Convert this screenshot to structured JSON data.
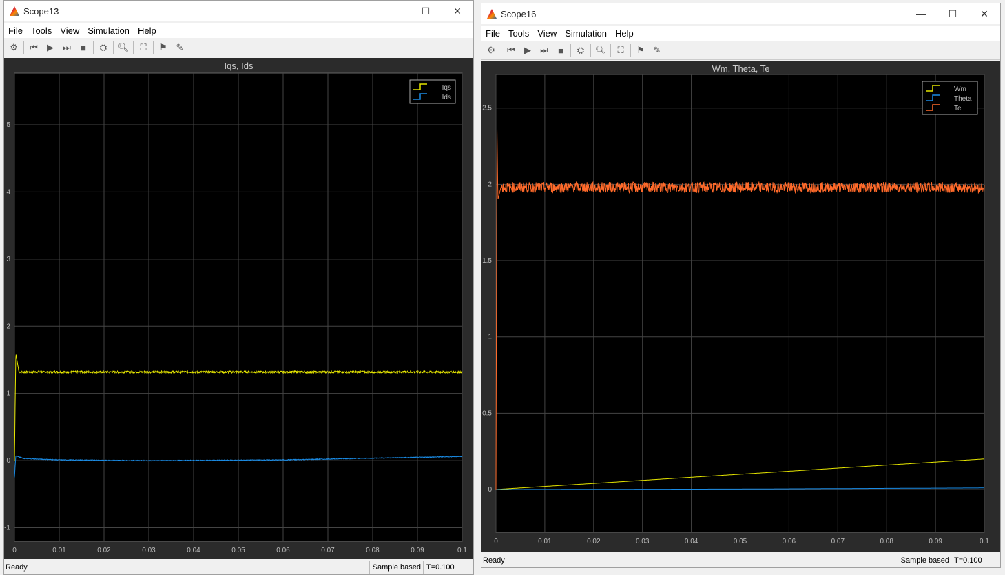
{
  "windows": [
    {
      "title": "Scope13",
      "menu": [
        "File",
        "Tools",
        "View",
        "Simulation",
        "Help"
      ],
      "plot_title": "Iqs, Ids",
      "status": {
        "left": "Ready",
        "mode": "Sample based",
        "time": "T=0.100"
      }
    },
    {
      "title": "Scope16",
      "menu": [
        "File",
        "Tools",
        "View",
        "Simulation",
        "Help"
      ],
      "plot_title": "Wm, Theta, Te",
      "status": {
        "left": "Ready",
        "mode": "Sample based",
        "time": "T=0.100"
      }
    }
  ],
  "toolbar_icons": [
    "settings-icon",
    "step-back-icon",
    "run-icon",
    "step-forward-icon",
    "stop-icon",
    "signal-select-icon",
    "zoom-icon",
    "fit-axes-icon",
    "trigger-icon",
    "measure-icon"
  ],
  "chart_data": [
    {
      "type": "line",
      "title": "Iqs, Ids",
      "xlim": [
        0,
        0.1
      ],
      "ylim": [
        -1.2,
        5.77
      ],
      "grid": true,
      "legend": "top-right",
      "xticks": [
        "0",
        "0.01",
        "0.02",
        "0.03",
        "0.04",
        "0.05",
        "0.06",
        "0.07",
        "0.08",
        "0.09",
        "0.1"
      ],
      "yticks": [
        "-1",
        "0",
        "1",
        "2",
        "3",
        "4",
        "5"
      ],
      "series": [
        {
          "name": "Iqs",
          "color": "#e6e600",
          "x": [
            0,
            0.0003,
            0.001,
            0.05,
            0.1
          ],
          "y": [
            0,
            1.6,
            1.32,
            1.32,
            1.32
          ]
        },
        {
          "name": "Ids",
          "color": "#1a8ce6",
          "x": [
            0,
            0.0003,
            0.002,
            0.01,
            0.03,
            0.06,
            0.1
          ],
          "y": [
            -0.25,
            0.07,
            0.03,
            0.01,
            0.0,
            0.01,
            0.06
          ]
        }
      ]
    },
    {
      "type": "line",
      "title": "Wm, Theta, Te",
      "xlim": [
        0,
        0.1
      ],
      "ylim": [
        -0.28,
        2.72
      ],
      "grid": true,
      "legend": "top-right",
      "xticks": [
        "0",
        "0.01",
        "0.02",
        "0.03",
        "0.04",
        "0.05",
        "0.06",
        "0.07",
        "0.08",
        "0.09",
        "0.1"
      ],
      "yticks": [
        "0",
        "0.5",
        "1",
        "1.5",
        "2",
        "2.5"
      ],
      "series": [
        {
          "name": "Wm",
          "color": "#e6e600",
          "x": [
            0,
            0.1
          ],
          "y": [
            0,
            0.2
          ]
        },
        {
          "name": "Theta",
          "color": "#1a8ce6",
          "x": [
            0,
            0.05,
            0.1
          ],
          "y": [
            0,
            0.003,
            0.01
          ]
        },
        {
          "name": "Te",
          "color": "#ff6a2a",
          "x": [
            0,
            0.0002,
            0.0004,
            0.001,
            0.1
          ],
          "y": [
            0,
            2.4,
            1.9,
            1.98,
            1.98
          ]
        }
      ]
    }
  ]
}
